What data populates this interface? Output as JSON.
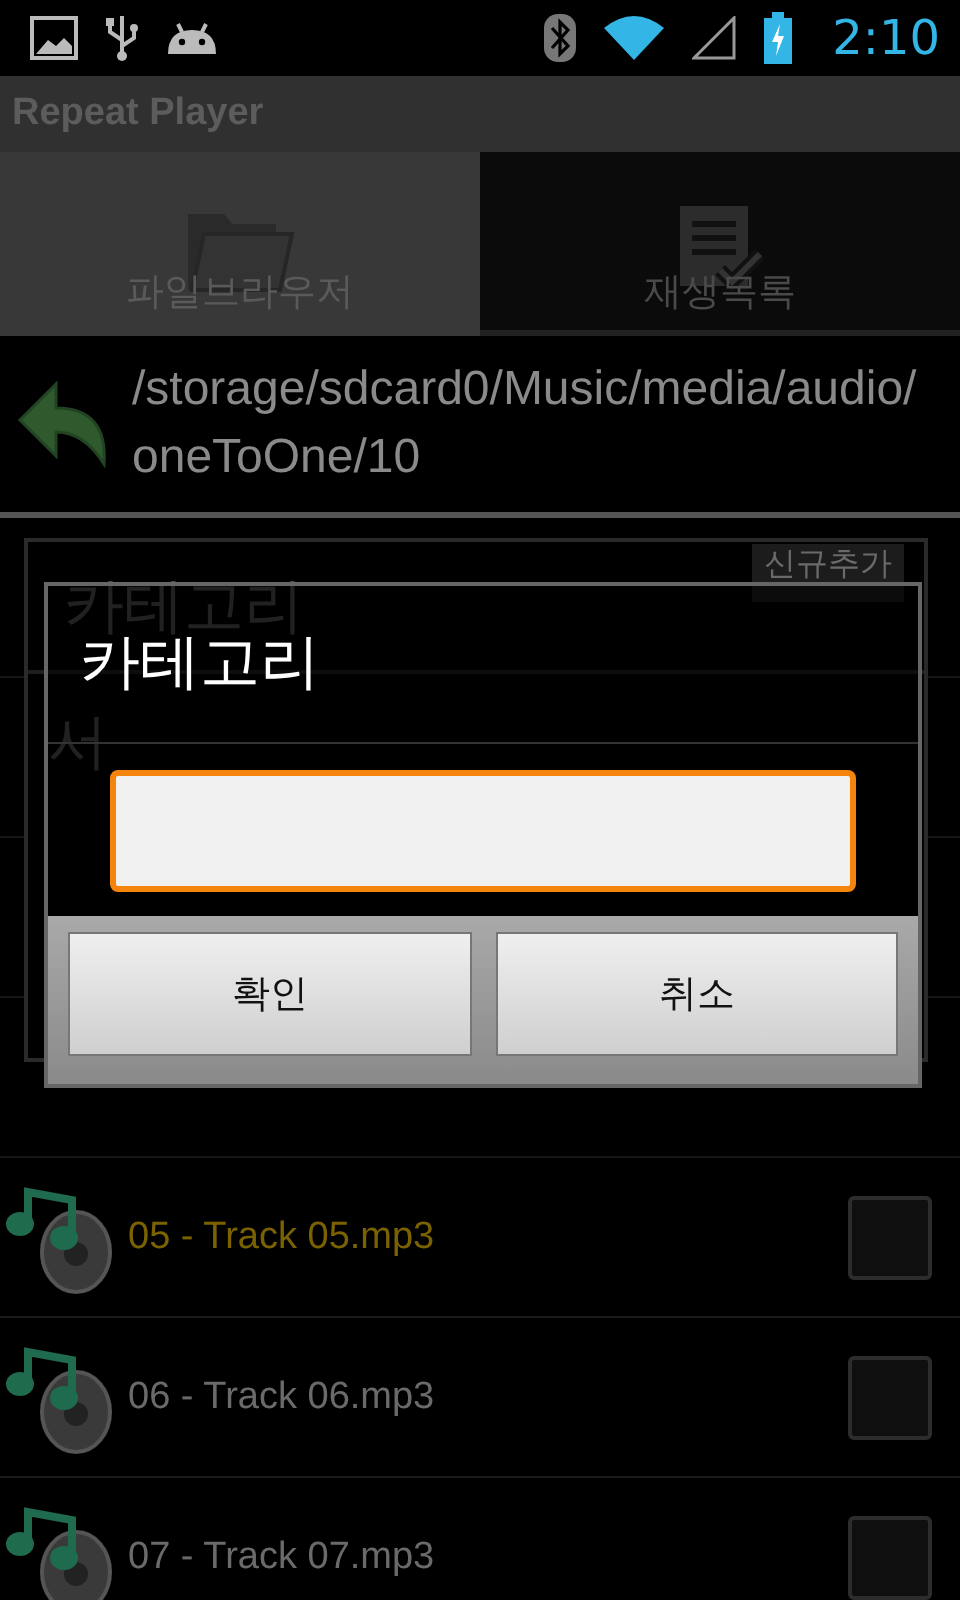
{
  "status_bar": {
    "time": "2:10"
  },
  "app_bar": {
    "title": "Repeat Player"
  },
  "tabs": [
    {
      "label": "파일브라우저",
      "selected": true
    },
    {
      "label": "재생목록",
      "selected": false
    }
  ],
  "path": {
    "text": "/storage/sdcard0/Music/media/audio/oneToOne/10"
  },
  "category_dialog": {
    "title": "카테고리",
    "add_button": "신규추가",
    "items": [
      "서"
    ]
  },
  "input_dialog": {
    "title": "카테고리",
    "buttons": [
      "확인",
      "취소"
    ]
  },
  "tracks": [
    {
      "name": "05 - Track 05.mp3",
      "playing": true,
      "checked": false
    },
    {
      "name": "06 - Track 06.mp3",
      "playing": false,
      "checked": false
    },
    {
      "name": "07 - Track 07.mp3",
      "playing": false,
      "checked": false
    }
  ]
}
